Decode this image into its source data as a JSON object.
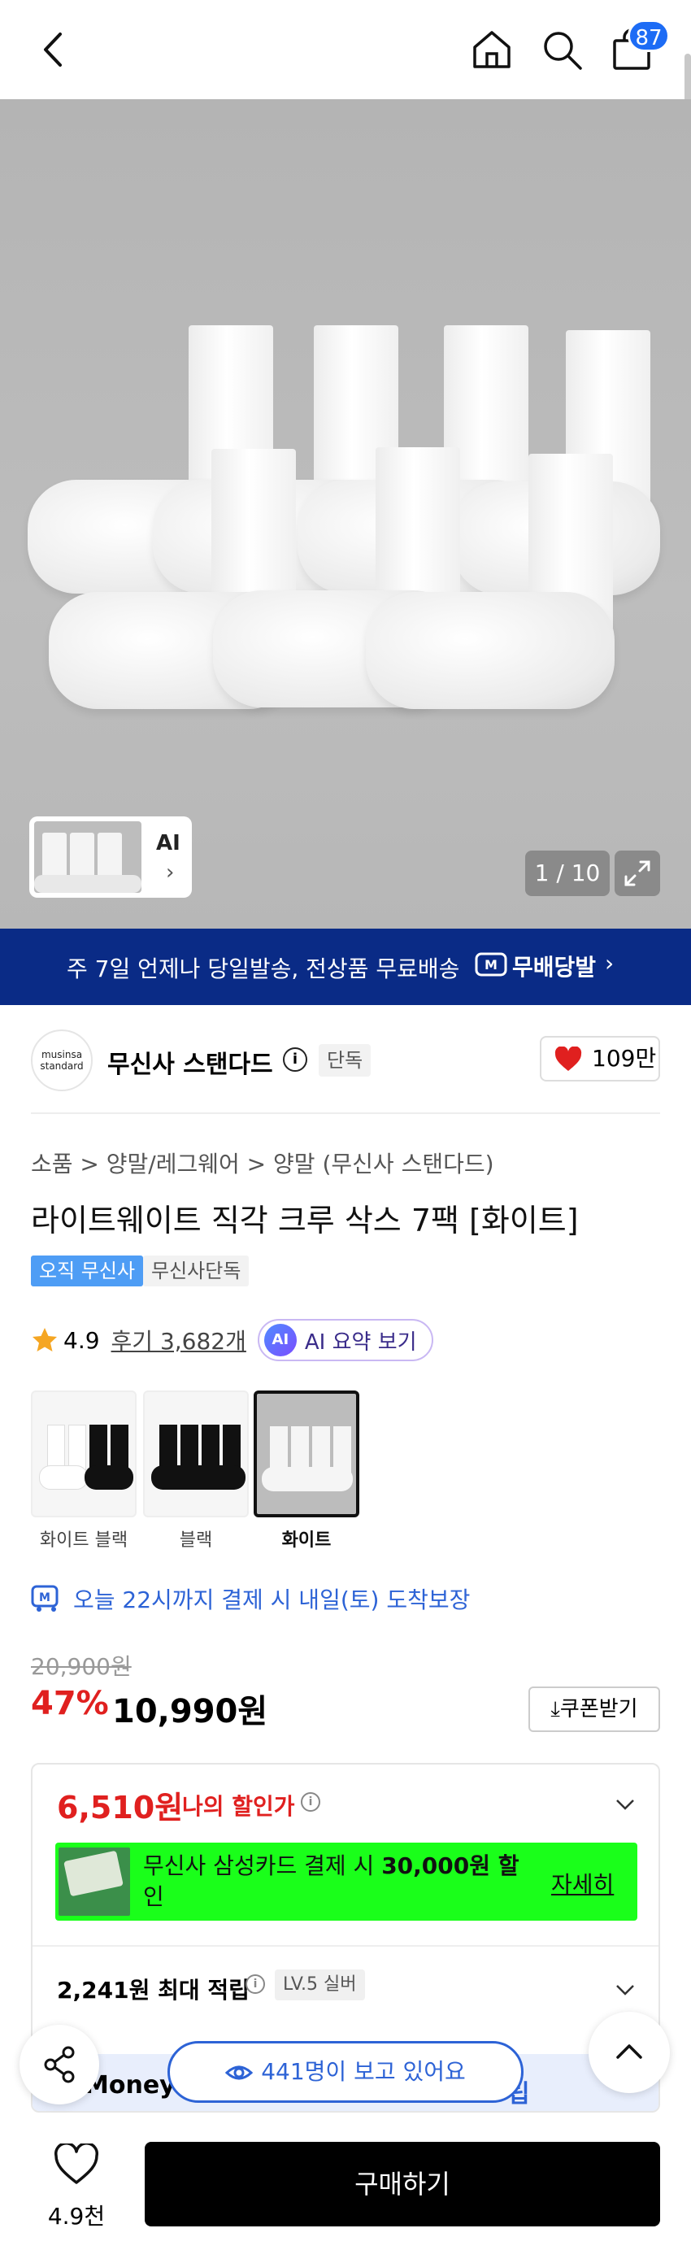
{
  "header": {
    "cart_count": "87"
  },
  "gallery": {
    "ai_label": "AI",
    "counter": "1 / 10"
  },
  "promo": {
    "text": "주 7일 언제나 당일발송, 전상품 무료배송",
    "brand": "무배당발",
    "chevron": "›"
  },
  "brand": {
    "logo_text_1": "musinsa",
    "logo_text_2": "standard",
    "name": "무신사 스탠다드",
    "exclusive_tag": "단독",
    "likes": "109만"
  },
  "breadcrumb": "소품 > 양말/레그웨어 > 양말 (무신사 스탠다드)",
  "product": {
    "title": "라이트웨이트 직각 크루 삭스 7팩 [화이트]",
    "tag_1": "오직 무신사",
    "tag_2": "무신사단독",
    "rating": "4.9",
    "reviews": "후기 3,682개",
    "ai_summary": "AI 요약 보기",
    "ai_badge": "AI"
  },
  "options": [
    {
      "label": "화이트 블랙",
      "selected": false
    },
    {
      "label": "블랙",
      "selected": false
    },
    {
      "label": "화이트",
      "selected": true
    }
  ],
  "delivery": "오늘 22시까지 결제 시 내일(토) 도착보장",
  "pricing": {
    "original": "20,900원",
    "discount": "47%",
    "price": "10,990원",
    "coupon": "쿠폰받기"
  },
  "benefits": {
    "my_price": "6,510원",
    "my_price_label": "나의 할인가",
    "card_text_1": "무신사 삼성카드 결제 시 ",
    "card_text_bold": "30,000원 할",
    "card_text_2": "인",
    "card_more": "자세히",
    "points": "2,241원 최대 적립",
    "level": "LV.5 실버",
    "money_label": "Money",
    "money_suffix": "립"
  },
  "floating": {
    "viewers": "441명이 보고 있어요"
  },
  "bottom": {
    "like_count": "4.9천",
    "buy": "구매하기"
  },
  "colors": {
    "accent_red": "#e0201f",
    "accent_blue": "#2d63d6",
    "promo_bg": "#0a2b86",
    "card_banner_bg": "#1aff1a",
    "badge_blue": "#1d6cf5"
  }
}
